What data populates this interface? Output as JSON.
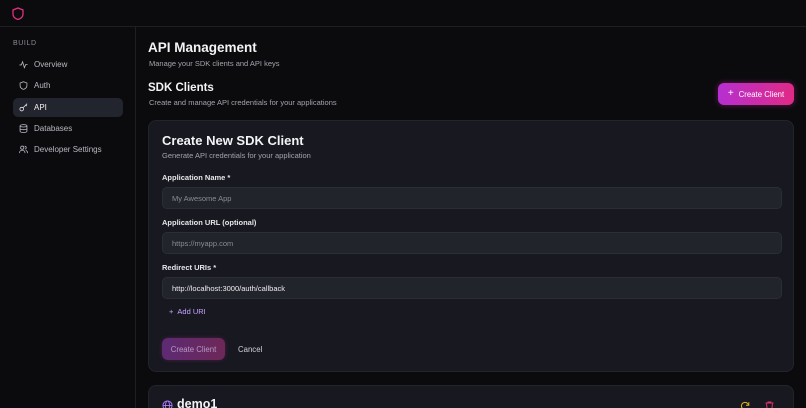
{
  "sidebar": {
    "section_label": "BUILD",
    "items": [
      {
        "label": "Overview",
        "icon": "activity-icon"
      },
      {
        "label": "Auth",
        "icon": "shield-icon"
      },
      {
        "label": "API",
        "icon": "key-icon",
        "active": true
      },
      {
        "label": "Databases",
        "icon": "database-icon"
      },
      {
        "label": "Developer Settings",
        "icon": "users-icon"
      }
    ]
  },
  "header": {
    "title": "API Management",
    "subtitle": "Manage your SDK clients and API keys"
  },
  "section": {
    "title": "SDK Clients",
    "subtitle": "Create and manage API credentials for your applications",
    "create_button": "Create Client"
  },
  "form": {
    "title": "Create New SDK Client",
    "subtitle": "Generate API credentials for your application",
    "app_name_label": "Application Name *",
    "app_name_placeholder": "My Awesome App",
    "app_url_label": "Application URL (optional)",
    "app_url_placeholder": "https://myapp.com",
    "redirect_label": "Redirect URIs *",
    "redirect_value": "http://localhost:3000/auth/callback",
    "add_uri": "Add URI",
    "submit": "Create Client",
    "cancel": "Cancel"
  },
  "clients": [
    {
      "name": "demo1"
    }
  ],
  "colors": {
    "accent_start": "#b62fd0",
    "accent_end": "#e02a86",
    "link": "#c9a4ff",
    "background": "#0b0b0e",
    "card": "#171820"
  }
}
